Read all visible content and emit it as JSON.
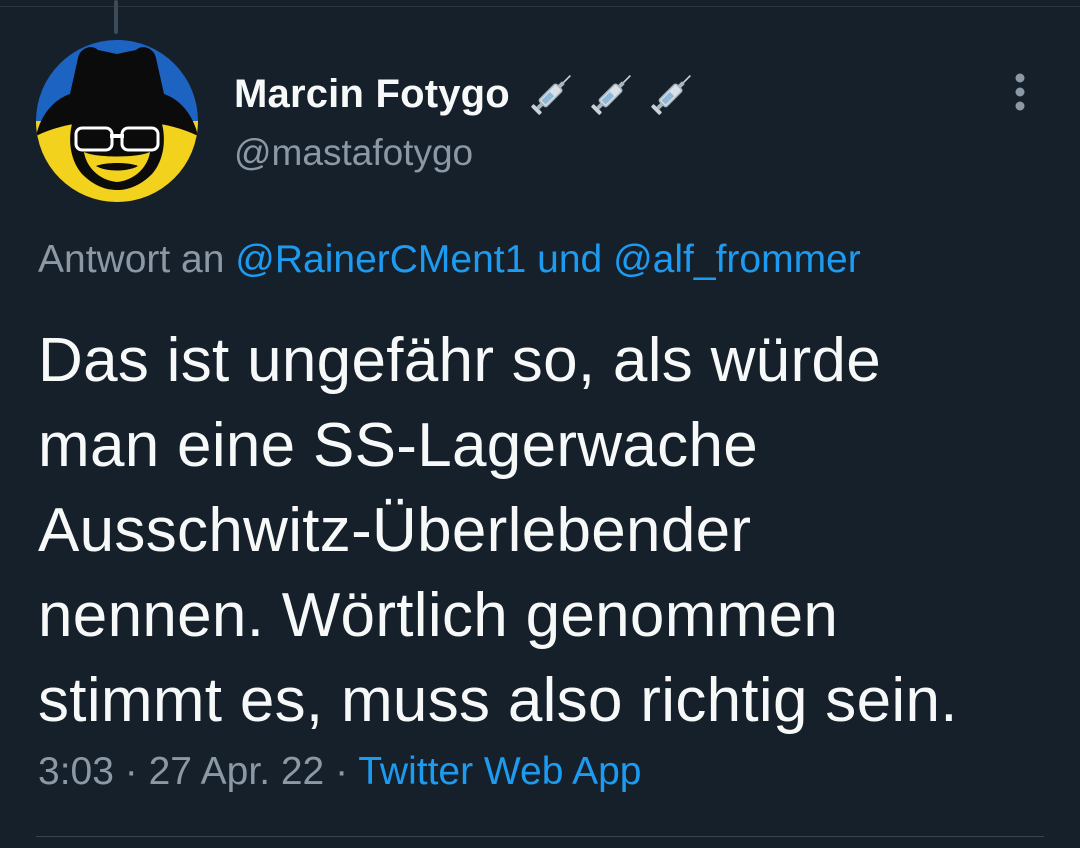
{
  "tweet": {
    "author": {
      "display_name": "Marcin Fotygo",
      "handle": "@mastafotygo",
      "name_emojis": [
        "syringe-icon",
        "syringe-icon",
        "syringe-icon"
      ]
    },
    "reply_to": {
      "prefix": "Antwort an",
      "mention_1": "@RainerCMent1",
      "connector": "und",
      "mention_2": "@alf_frommer"
    },
    "text_lines": [
      "Das ist ungefähr so, als würde",
      "man eine SS-Lagerwache",
      "Ausschwitz-Überlebender",
      "nennen. Wörtlich genommen",
      "stimmt es, muss also richtig sein."
    ],
    "time": "3:03",
    "separator": "·",
    "date": "27 Apr. 22",
    "source": "Twitter Web App"
  },
  "colors": {
    "background": "#15202b",
    "link": "#1d9bf0",
    "secondary_text": "#8b98a5",
    "primary_text": "#f7f9f9",
    "avatar_blue": "#1d63c2",
    "avatar_yellow": "#f2d21c"
  }
}
